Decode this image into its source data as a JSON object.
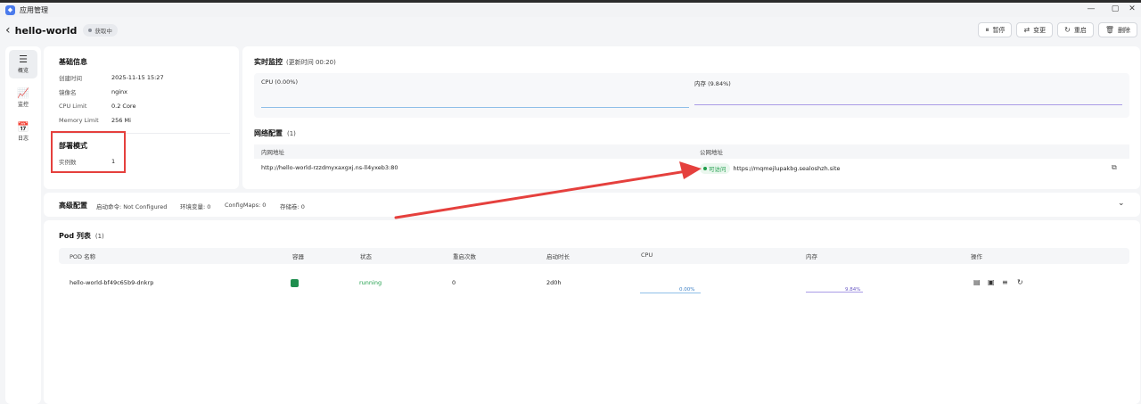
{
  "window": {
    "title": "应用管理",
    "controls": [
      "—",
      "▢",
      "✕"
    ]
  },
  "header": {
    "app_name": "hello-world",
    "status": "获取中"
  },
  "actions": [
    {
      "icon": "pause-icon",
      "glyph": "⏸",
      "label": "暂停"
    },
    {
      "icon": "swap-icon",
      "glyph": "⇄",
      "label": "变更"
    },
    {
      "icon": "restart-icon",
      "glyph": "↻",
      "label": "重启"
    },
    {
      "icon": "trash-icon",
      "glyph": "🗑",
      "label": "删除"
    }
  ],
  "nav": [
    {
      "label": "概览",
      "glyph": "☰",
      "active": true
    },
    {
      "label": "监控",
      "glyph": "📈",
      "active": false
    },
    {
      "label": "日志",
      "glyph": "📅",
      "active": false
    }
  ],
  "basic": {
    "title": "基础信息",
    "rows": [
      {
        "k": "创建时间",
        "v": "2025-11-15 15:27"
      },
      {
        "k": "镜像名",
        "v": "nginx"
      },
      {
        "k": "CPU Limit",
        "v": "0.2 Core"
      },
      {
        "k": "Memory Limit",
        "v": "256 Mi"
      }
    ]
  },
  "deploy": {
    "title": "部署模式",
    "k": "实例数",
    "v": "1"
  },
  "monitor": {
    "title": "实时监控",
    "update": "(更新时间  00:20)",
    "cpu_label": "CPU  (0.00%)",
    "mem_label": "内存  (9.84%)",
    "cpu_value": 0.0,
    "mem_value": 9.84
  },
  "network": {
    "title": "网络配置",
    "count": "(1)",
    "col_internal": "内网地址",
    "col_public": "公网地址",
    "internal": "http://hello-world-rzzdmyxaxgxj.ns-ll4yxeb3:80",
    "badge": "可访问",
    "public": "https://mqmejlupakbg.sealoshzh.site"
  },
  "advanced": {
    "title": "高级配置",
    "items": [
      "启动命令: Not Configured",
      "环境变量: 0",
      "ConfigMaps: 0",
      "存储卷: 0"
    ]
  },
  "pods": {
    "title": "Pod 列表",
    "count": "(1)",
    "columns": [
      "POD 名称",
      "容器",
      "状态",
      "重启次数",
      "启动时长",
      "CPU",
      "内存",
      "操作"
    ],
    "row": {
      "name": "hello-world-bf49c65b9-dnkrp",
      "status": "running",
      "restarts": "0",
      "uptime": "2d0h",
      "cpu": "0.00%",
      "mem": "9.84%"
    }
  },
  "colors": {
    "accent_red": "#e5403d",
    "running": "#1e9e4a",
    "cpu_line": "#8fbfe8",
    "mem_line": "#a99be6"
  }
}
